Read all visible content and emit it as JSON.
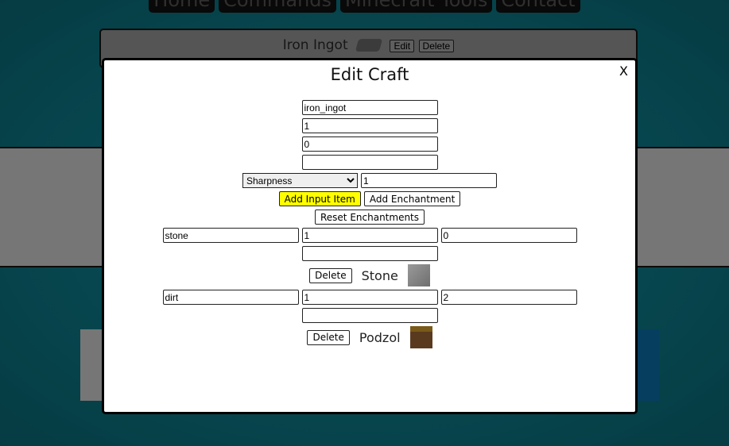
{
  "nav": [
    "Home",
    "Commands",
    "Minecraft Tools",
    "Contact"
  ],
  "card": {
    "name": "Iron Ingot",
    "edit": "Edit",
    "delete": "Delete"
  },
  "modal": {
    "title": "Edit Craft",
    "close": "X",
    "fields": [
      "iron_ingot",
      "1",
      "0",
      ""
    ],
    "enchant_select": "Sharpness",
    "enchant_level": "1",
    "add_input": "Add Input Item",
    "add_enchant": "Add Enchantment",
    "reset": "Reset Enchantments",
    "inputs": [
      {
        "id": "stone",
        "count": "1",
        "data": "0",
        "extra": "",
        "delete": "Delete",
        "name": "Stone",
        "icon": "stone-block-icon"
      },
      {
        "id": "dirt",
        "count": "1",
        "data": "2",
        "extra": "",
        "delete": "Delete",
        "name": "Podzol",
        "icon": "podzol-block-icon"
      }
    ]
  }
}
